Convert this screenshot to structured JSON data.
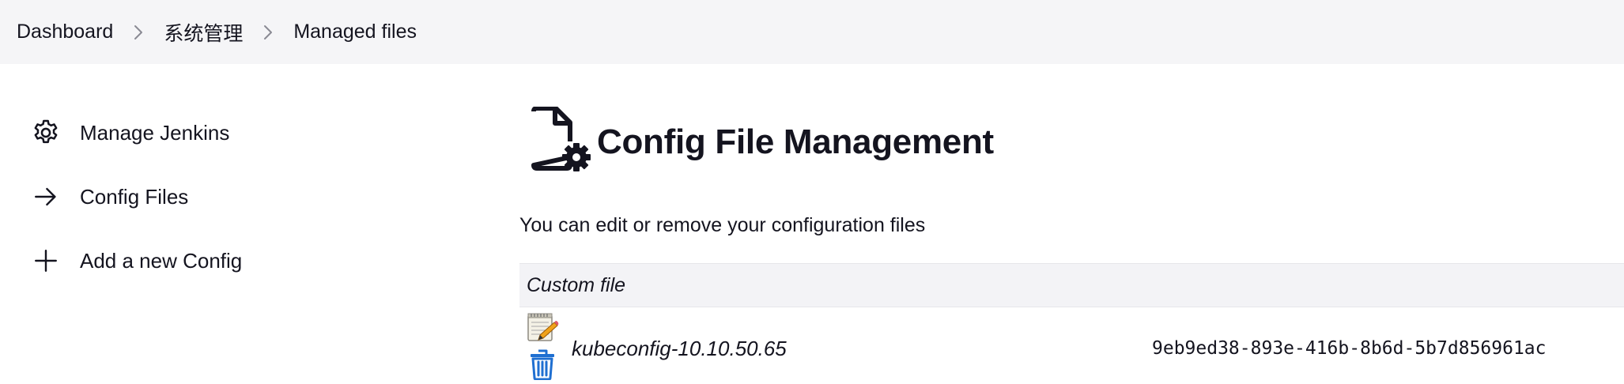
{
  "breadcrumb": {
    "items": [
      {
        "label": "Dashboard"
      },
      {
        "label": "系统管理"
      },
      {
        "label": "Managed files"
      }
    ]
  },
  "sidebar": {
    "items": [
      {
        "label": "Manage Jenkins",
        "icon": "gear-icon"
      },
      {
        "label": "Config Files",
        "icon": "arrow-right-icon"
      },
      {
        "label": "Add a new Config",
        "icon": "plus-icon"
      }
    ]
  },
  "main": {
    "title": "Config File Management",
    "title_icon": "config-file-gear-icon",
    "description": "You can edit or remove your configuration files",
    "table": {
      "section_header": "Custom file",
      "rows": [
        {
          "name": "kubeconfig-10.10.50.65",
          "id": "9eb9ed38-893e-416b-8b6d-5b7d856961ac",
          "edit_icon": "edit-notepad-icon",
          "delete_icon": "trash-icon"
        }
      ]
    }
  },
  "colors": {
    "breadcrumb_bg": "#f5f5f7",
    "text": "#14141f",
    "table_header_bg": "#f3f3f6",
    "trash_blue": "#1f6fd1"
  }
}
